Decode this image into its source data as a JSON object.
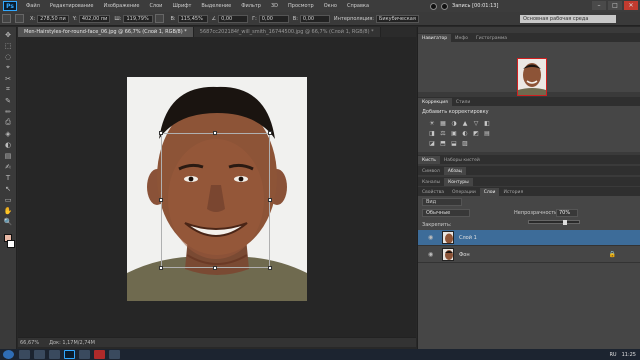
{
  "app": {
    "logo": "Ps",
    "menu": [
      "Файл",
      "Редактирование",
      "Изображение",
      "Слои",
      "Шрифт",
      "Выделение",
      "Фильтр",
      "3D",
      "Просмотр",
      "Окно",
      "Справка"
    ],
    "recording": "Запись [00:01:13]",
    "window_buttons": [
      "–",
      "□",
      "✕"
    ]
  },
  "options": {
    "x_label": "X:",
    "x_value": "278,50 пи",
    "y_label": "Y:",
    "y_value": "402,00 пи",
    "w_label": "Ш:",
    "w_value": "119,79%",
    "h_label": "В:",
    "h_value": "115,45%",
    "angle_value": "0,00",
    "h2_label": "Г:",
    "h2_value": "0,00",
    "v_label": "В:",
    "v_value": "0,00",
    "interp_label": "Интерполяция:",
    "interp_value": "Бикубическая",
    "workspace": "Основная рабочая среда"
  },
  "tools": [
    "✥",
    "⬚",
    "◌",
    "⌖",
    "✂",
    "⌗",
    "✎",
    "✏",
    "⎙",
    "◈",
    "◐",
    "▤",
    "✍",
    "T",
    "↖",
    "▭",
    "✋",
    "🔍"
  ],
  "document_tabs": [
    {
      "label": "Men-Hairstyles-for-round-face_06.jpg @ 66,7% (Слой 1, RGB/8) *",
      "active": true
    },
    {
      "label": "5687cc202184f_will_smith_16744500.jpg @ 66,7% (Слой 1, RGB/8) *",
      "active": false
    }
  ],
  "status": {
    "zoom": "66,67%",
    "doc": "Док: 1,17М/2,74М"
  },
  "panels": {
    "navigator_tabs": [
      "Навигатор",
      "Инфо",
      "Гистограмма"
    ],
    "correction_tabs": [
      "Коррекция",
      "Стили"
    ],
    "correction_title": "Добавить корректировку",
    "correction_row1": [
      "☀",
      "▦",
      "◑",
      "▲",
      "▽",
      "◧"
    ],
    "correction_row2": [
      "◨",
      "⚖",
      "▣",
      "◐",
      "◩",
      "▤"
    ],
    "correction_row3": [
      "◪",
      "⬒",
      "⬓",
      "▨"
    ],
    "brush_tabs": [
      "Кисть",
      "Наборы кистей"
    ],
    "symbols_tabs": [
      "Символ",
      "Абзац"
    ],
    "channels_tabs": [
      "Каналы",
      "Контуры"
    ],
    "layers_tabs": [
      "Свойства",
      "Операции",
      "Слои",
      "История"
    ],
    "kind_label": "Вид",
    "blend_mode": "Обычные",
    "opacity_label": "Непрозрачность:",
    "opacity_value": "70%",
    "lock_label": "Закрепить:",
    "layers": [
      {
        "name": "Слой 1",
        "selected": true
      },
      {
        "name": "Фон",
        "selected": false
      }
    ]
  },
  "taskbar": {
    "lang": "RU",
    "time": "11:25"
  },
  "colors": {
    "ps_blue": "#31a8ff",
    "selected_layer": "#3d6c99",
    "close_red": "#c23b2f"
  }
}
